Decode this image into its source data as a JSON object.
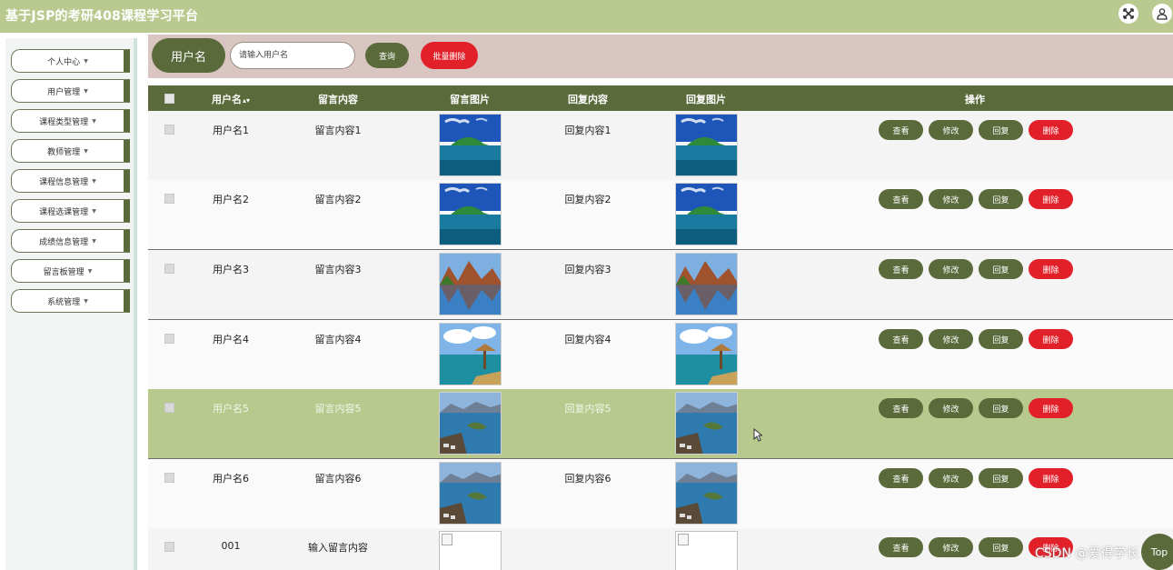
{
  "app": {
    "title": "基于JSP的考研408课程学习平台"
  },
  "header_icons": [
    "fullscreen-icon",
    "user-icon"
  ],
  "sidebar": {
    "items": [
      {
        "label": "个人中心"
      },
      {
        "label": "用户管理"
      },
      {
        "label": "课程类型管理"
      },
      {
        "label": "教师管理"
      },
      {
        "label": "课程信息管理"
      },
      {
        "label": "课程选课管理"
      },
      {
        "label": "成绩信息管理"
      },
      {
        "label": "留言板管理"
      },
      {
        "label": "系统管理"
      }
    ]
  },
  "search": {
    "field_label": "用户名",
    "placeholder": "请输入用户名",
    "query_label": "查询",
    "batch_delete_label": "批量删除"
  },
  "table": {
    "headers": {
      "username": "用户名",
      "message": "留言内容",
      "message_image": "留言图片",
      "reply": "回复内容",
      "reply_image": "回复图片",
      "actions": "操作"
    },
    "sort_icon": "▴▾",
    "actions": {
      "view": "查看",
      "edit": "修改",
      "reply": "回复",
      "delete": "删除"
    },
    "rows": [
      {
        "username": "用户名1",
        "message": "留言内容1",
        "reply": "回复内容1",
        "image": "lake-island"
      },
      {
        "username": "用户名2",
        "message": "留言内容2",
        "reply": "回复内容2",
        "image": "lake-island"
      },
      {
        "username": "用户名3",
        "message": "留言内容3",
        "reply": "回复内容3",
        "image": "autumn-lake"
      },
      {
        "username": "用户名4",
        "message": "留言内容4",
        "reply": "回复内容4",
        "image": "beach-hut"
      },
      {
        "username": "用户名5",
        "message": "留言内容5",
        "reply": "回复内容5",
        "image": "coast-village"
      },
      {
        "username": "用户名6",
        "message": "留言内容6",
        "reply": "回复内容6",
        "image": "coast-village"
      },
      {
        "username": "001",
        "message": "输入留言内容",
        "reply": "",
        "image": "broken"
      }
    ],
    "selected_row": 5
  },
  "footer": {
    "watermark": "CSDN @爱得学长",
    "top_button": "Top"
  }
}
